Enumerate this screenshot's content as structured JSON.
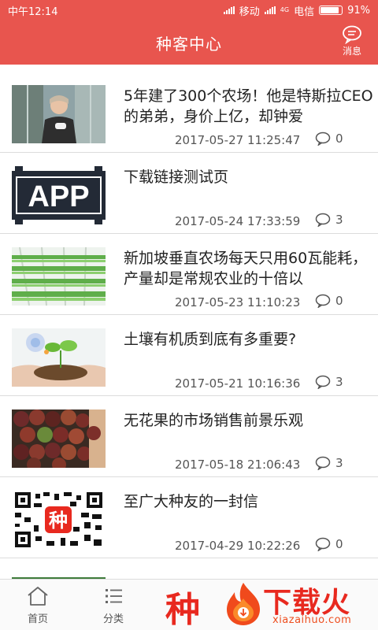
{
  "status_bar": {
    "time": "中午12:14",
    "carrier1": "移动",
    "net_label": "4G",
    "carrier2": "电信",
    "battery": "91%"
  },
  "header": {
    "title": "种客中心",
    "message_label": "消息"
  },
  "articles": [
    {
      "title": "5年建了300个农场！他是特斯拉CEO的弟弟，身价上亿，却钟爱",
      "date": "2017-05-27 11:25:47",
      "comments": "0"
    },
    {
      "title": "下载链接测试页",
      "date": "2017-05-24 17:33:59",
      "comments": "3",
      "thumb_text": "APP"
    },
    {
      "title": "新加坡垂直农场每天只用60瓦能耗，产量却是常规农业的十倍以",
      "date": "2017-05-23 11:10:23",
      "comments": "0"
    },
    {
      "title": "土壤有机质到底有多重要?",
      "date": "2017-05-21 10:16:36",
      "comments": "3"
    },
    {
      "title": "无花果的市场销售前景乐观",
      "date": "2017-05-18 21:06:43",
      "comments": "3"
    },
    {
      "title": "至广大种友的一封信",
      "date": "2017-04-29 10:22:26",
      "comments": "0",
      "thumb_text": "种"
    }
  ],
  "tabbar": {
    "home_label": "首页",
    "category_label": "分类",
    "center_text": "种"
  },
  "watermark": {
    "text": "下载火",
    "url": "xiazaihuo.com"
  },
  "colors": {
    "primary": "#e8554e",
    "brand_red": "#e8291f"
  }
}
